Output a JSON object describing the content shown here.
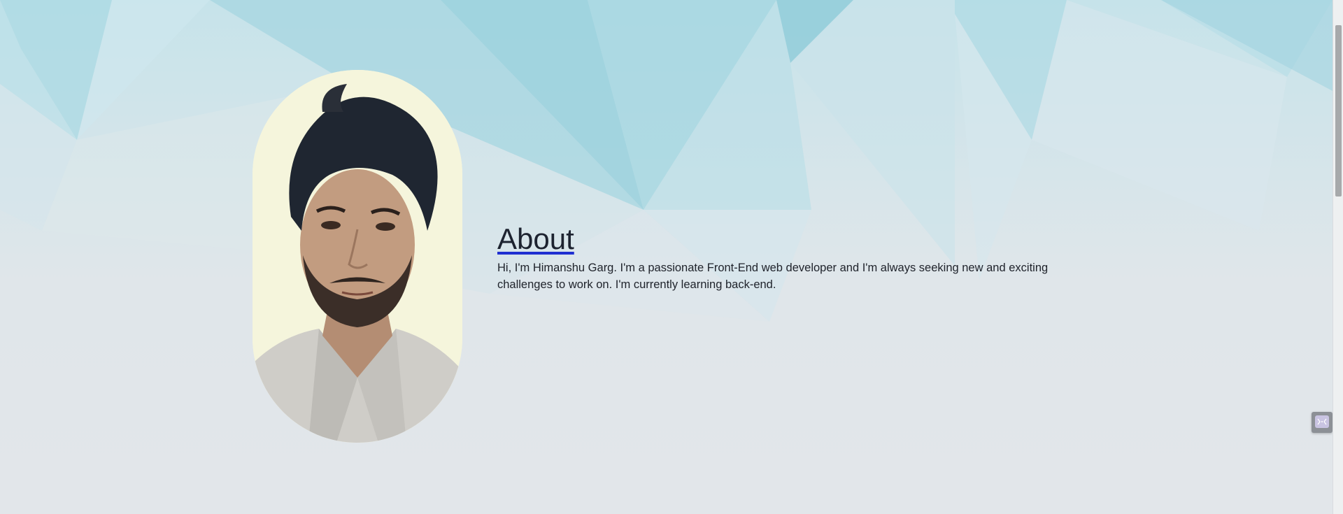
{
  "about": {
    "heading": "About",
    "description": "Hi, I'm Himanshu Garg. I'm a passionate Front-End web developer and I'm always seeking new and exciting challenges to work on. I'm currently learning back-end."
  },
  "profile_photo": {
    "icon": "profile-photo"
  },
  "floating_widget": {
    "icon": "chat-icon"
  },
  "colors": {
    "background": "#e2e6ea",
    "polygon_accent": "#8ecfdc",
    "heading_underline": "#1f2fd1",
    "photo_backdrop": "#f5f5dc"
  }
}
